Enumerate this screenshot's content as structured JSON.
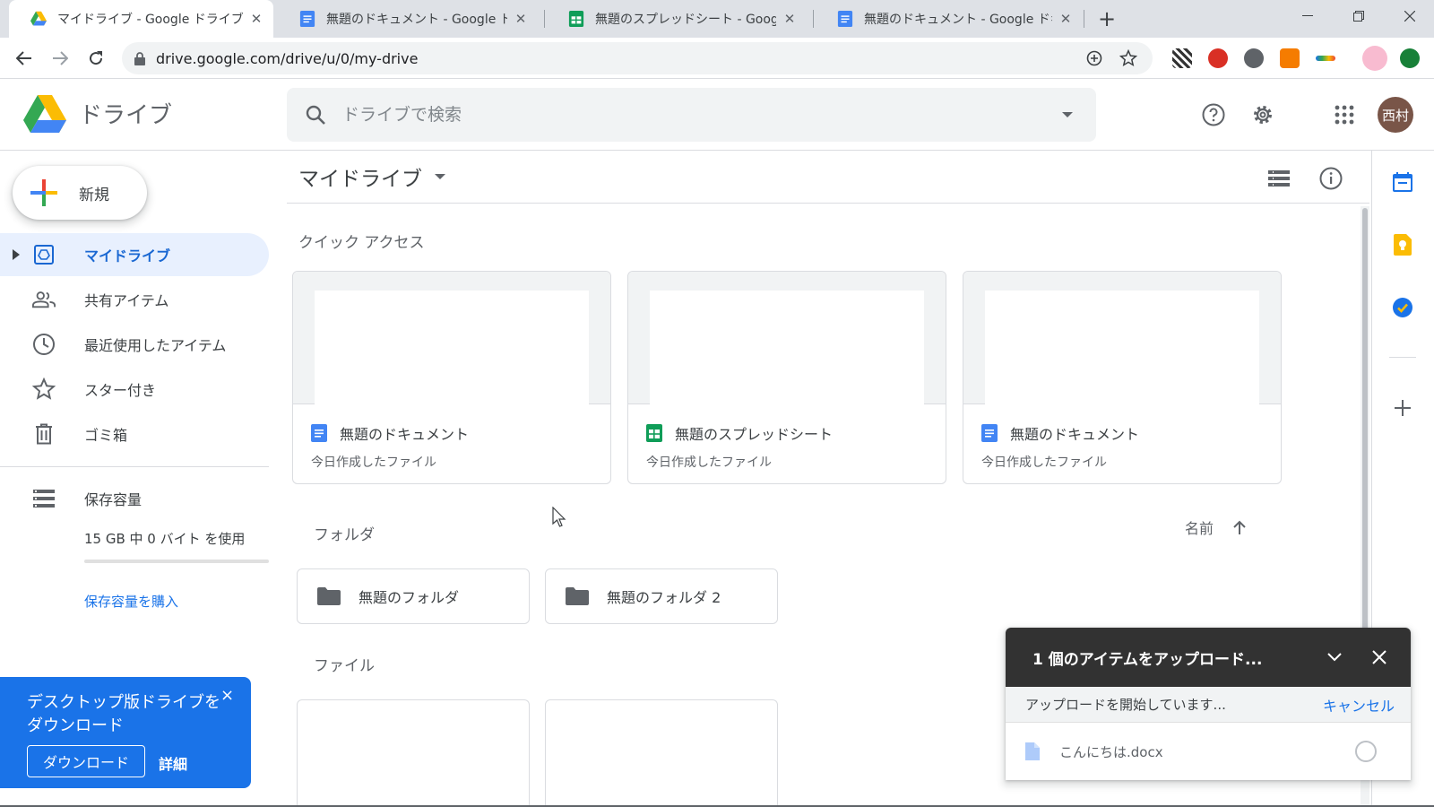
{
  "browser": {
    "tabs": [
      {
        "title": "マイドライブ - Google ドライブ",
        "icon": "drive-icon"
      },
      {
        "title": "無題のドキュメント - Google ドキュメ",
        "icon": "docs-icon"
      },
      {
        "title": "無題のスプレッドシート - Google スプ",
        "icon": "sheets-icon"
      },
      {
        "title": "無題のドキュメント - Google ドキュメ",
        "icon": "docs-icon"
      }
    ],
    "url": "drive.google.com/drive/u/0/my-drive"
  },
  "header": {
    "brand": "ドライブ",
    "search_placeholder": "ドライブで検索",
    "avatar": "西村"
  },
  "sidebar": {
    "new_label": "新規",
    "items": [
      {
        "label": "マイドライブ",
        "icon": "my-drive-icon",
        "active": true
      },
      {
        "label": "共有アイテム",
        "icon": "people-icon"
      },
      {
        "label": "最近使用したアイテム",
        "icon": "clock-icon"
      },
      {
        "label": "スター付き",
        "icon": "star-icon"
      },
      {
        "label": "ゴミ箱",
        "icon": "trash-icon"
      }
    ],
    "storage_label": "保存容量",
    "storage_text": "15 GB 中 0 バイト を使用",
    "storage_used_fraction": 0,
    "buy_storage": "保存容量を購入",
    "promo": {
      "text": "デスクトップ版ドライブをダウンロード",
      "close": "×",
      "download_button": "ダウンロード",
      "details_link": "詳細"
    }
  },
  "main": {
    "title": "マイドライブ",
    "quick_access_label": "クイック アクセス",
    "quick_access": [
      {
        "name": "無題のドキュメント",
        "subtitle": "今日作成したファイル",
        "type": "docs"
      },
      {
        "name": "無題のスプレッドシート",
        "subtitle": "今日作成したファイル",
        "type": "sheets"
      },
      {
        "name": "無題のドキュメント",
        "subtitle": "今日作成したファイル",
        "type": "docs"
      }
    ],
    "folders_label": "フォルダ",
    "sort_label": "名前",
    "folders": [
      {
        "name": "無題のフォルダ"
      },
      {
        "name": "無題のフォルダ 2"
      }
    ],
    "files_label": "ファイル"
  },
  "upload": {
    "title": "1 個のアイテムをアップロード...",
    "status": "アップロードを開始しています...",
    "cancel": "キャンセル",
    "file_name": "こんにちは.docx"
  },
  "colors": {
    "accent": "#1a73e8",
    "docs": "#4285f4",
    "sheets": "#0f9d58",
    "upload_header": "#323232",
    "avatar": "#795548"
  }
}
